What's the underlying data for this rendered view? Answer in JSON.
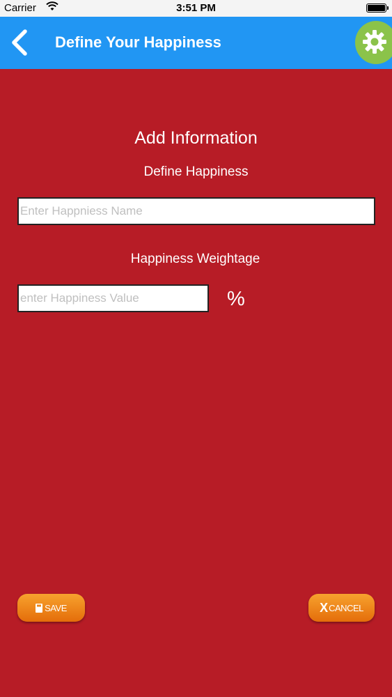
{
  "status_bar": {
    "carrier": "Carrier",
    "time": "3:51 PM"
  },
  "nav": {
    "title": "Define Your Happiness",
    "color": "#2196f3",
    "settings_color": "#8bc34a"
  },
  "form": {
    "heading": "Add Information",
    "name_label": "Define Happiness",
    "name_placeholder": "Enter Happniess Name",
    "weight_label": "Happiness Weightage",
    "value_placeholder": "enter Happiness Value",
    "value_unit": "%"
  },
  "actions": {
    "save_label": "SAVE",
    "cancel_icon": "X",
    "cancel_label": "CANCEL"
  },
  "theme": {
    "background": "#b71c26",
    "button_orange": "#f08a1c"
  }
}
